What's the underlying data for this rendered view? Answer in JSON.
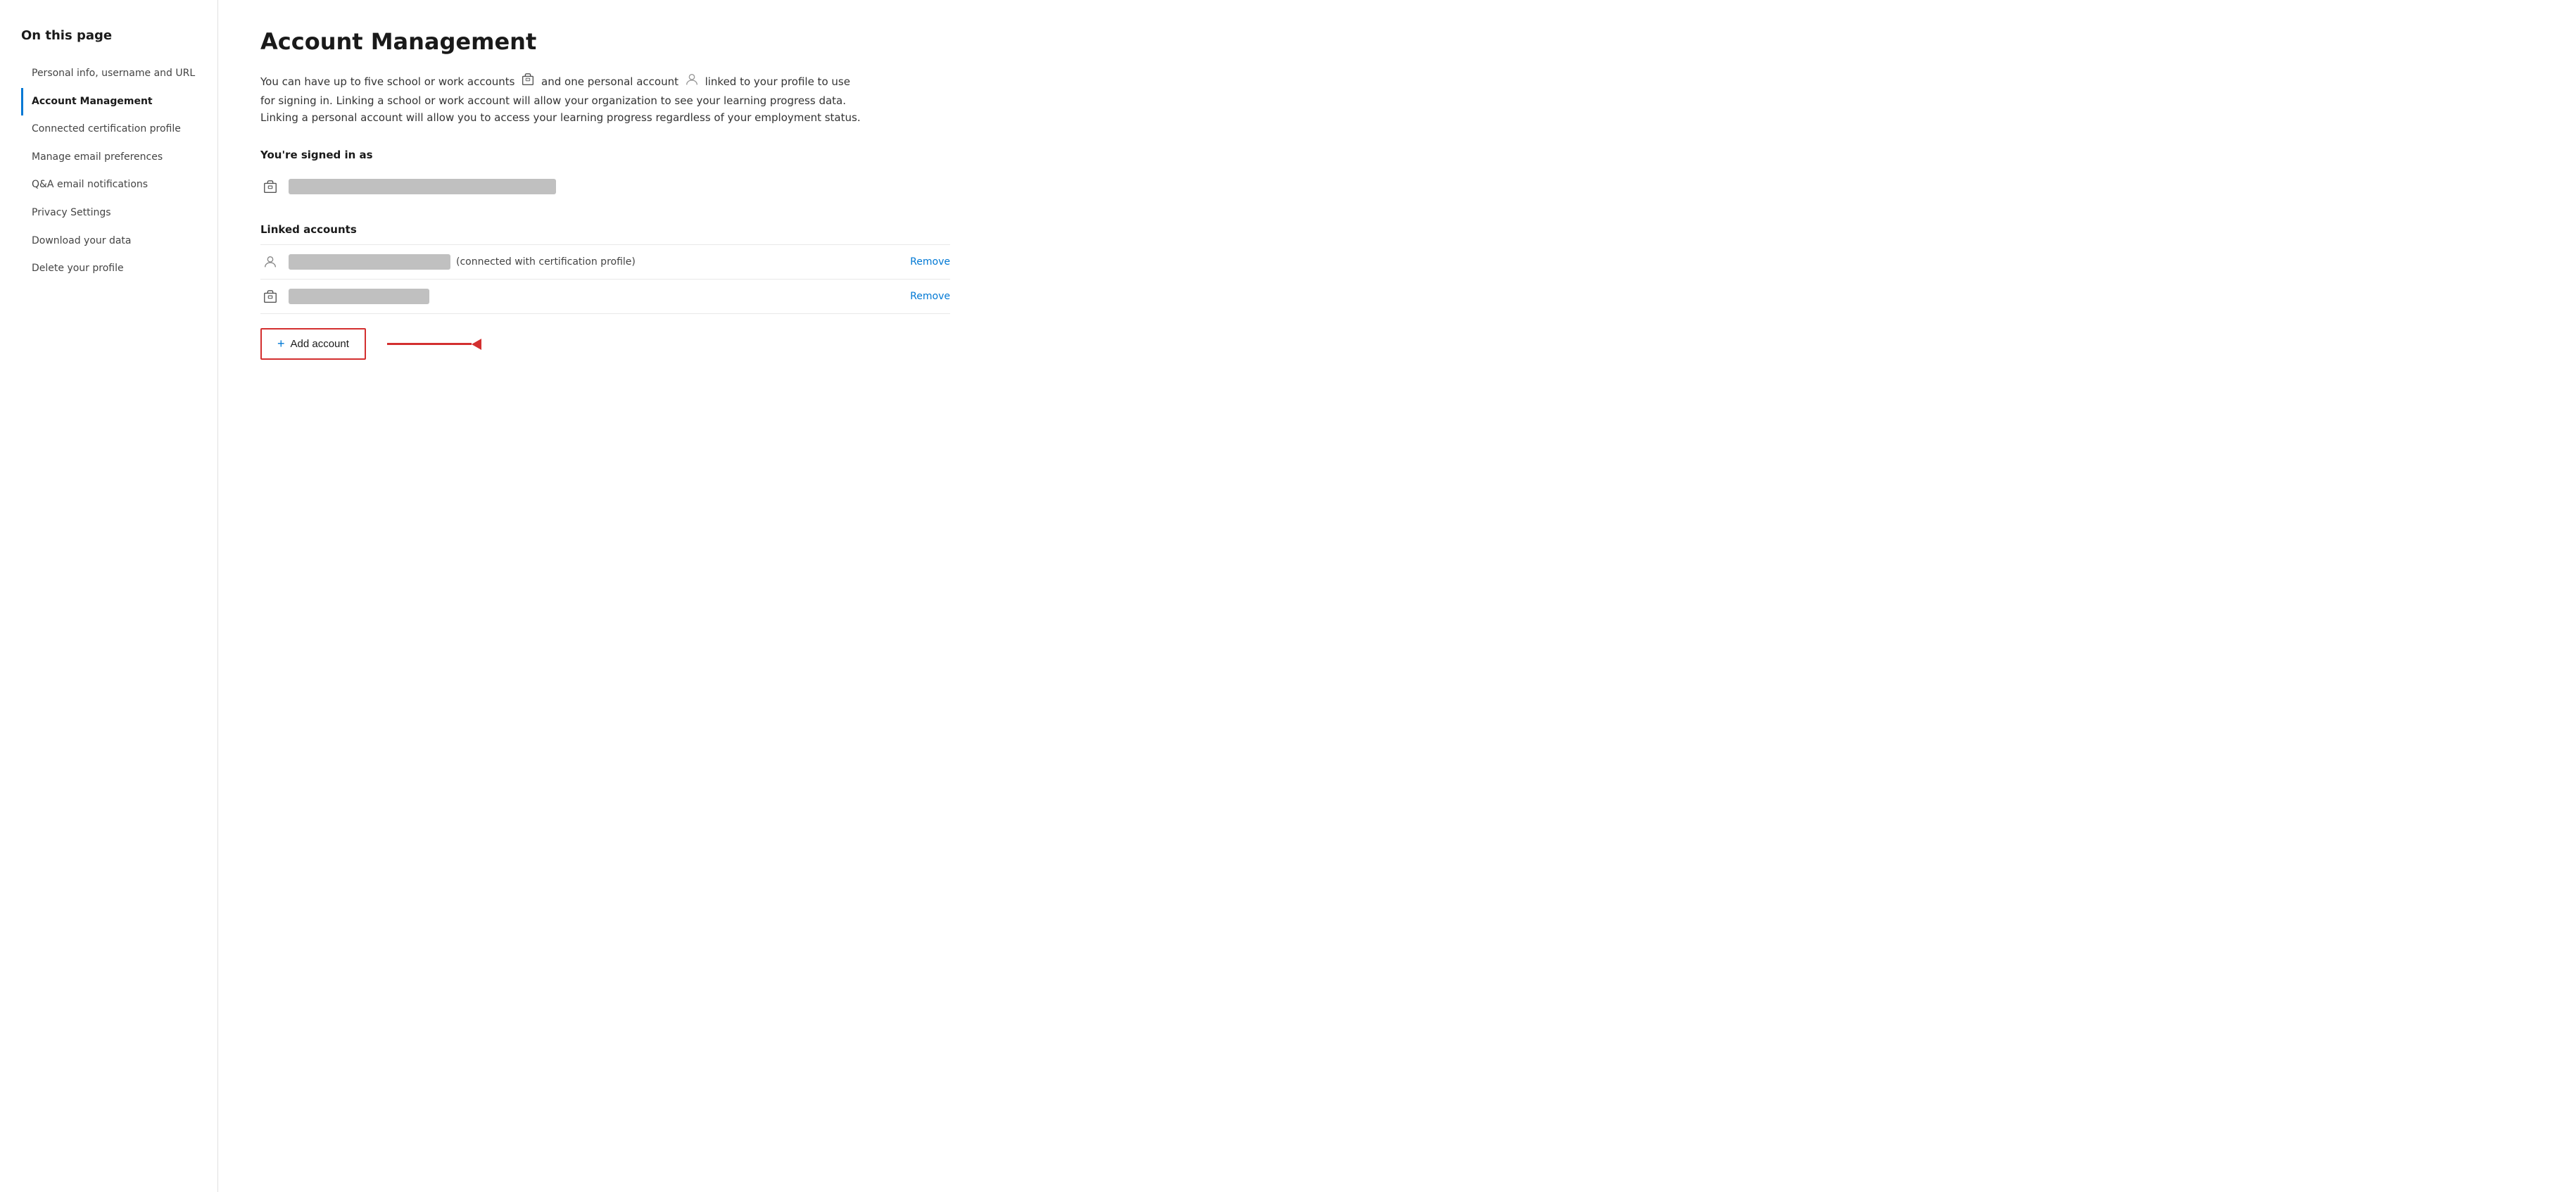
{
  "sidebar": {
    "title": "On this page",
    "items": [
      {
        "id": "personal-info",
        "label": "Personal info, username and URL",
        "active": false
      },
      {
        "id": "account-management",
        "label": "Account Management",
        "active": true
      },
      {
        "id": "connected-cert",
        "label": "Connected certification profile",
        "active": false
      },
      {
        "id": "email-prefs",
        "label": "Manage email preferences",
        "active": false
      },
      {
        "id": "qa-email",
        "label": "Q&A email notifications",
        "active": false
      },
      {
        "id": "privacy",
        "label": "Privacy Settings",
        "active": false
      },
      {
        "id": "download-data",
        "label": "Download your data",
        "active": false
      },
      {
        "id": "delete-profile",
        "label": "Delete your profile",
        "active": false
      }
    ]
  },
  "main": {
    "page_title": "Account Management",
    "description_part1": "You can have up to five school or work accounts",
    "description_part2": "and one personal account",
    "description_part3": "linked to your profile to use for signing in. Linking a school or work account will allow your organization to see your learning progress data. Linking a personal account will allow you to access your learning progress regardless of your employment status.",
    "signed_in_label": "You're signed in as",
    "linked_accounts_label": "Linked accounts",
    "cert_profile_text": "(connected with certification profile)",
    "remove_label": "Remove",
    "add_account_label": "Add account",
    "plus_symbol": "+"
  }
}
